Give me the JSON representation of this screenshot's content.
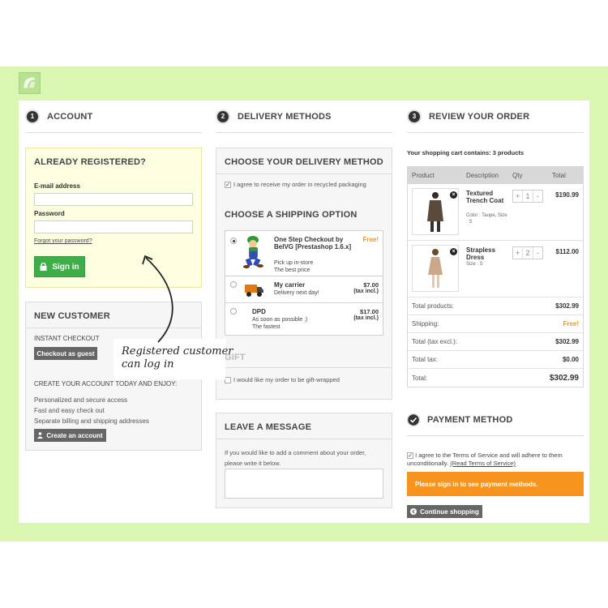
{
  "brand": {
    "colors": {
      "band": "#d9f7b1",
      "green": "#3fae49",
      "orange": "#f7941d",
      "free": "#f7941d"
    }
  },
  "steps": {
    "account": {
      "num": "1",
      "title": "ACCOUNT"
    },
    "delivery": {
      "num": "2",
      "title": "DELIVERY METHODS"
    },
    "review": {
      "num": "3",
      "title": "REVIEW YOUR ORDER"
    },
    "payment": {
      "icon": "check-circle-icon",
      "title": "PAYMENT METHOD"
    }
  },
  "login": {
    "title": "ALREADY REGISTERED?",
    "email_label": "E-mail address",
    "email_value": "",
    "password_label": "Password",
    "password_value": "",
    "forgot": "Forgot your password?",
    "signin": "Sign in"
  },
  "new_customer": {
    "title": "NEW CUSTOMER",
    "instant": "INSTANT CHECKOUT",
    "guest_btn": "Checkout as guest",
    "create_head": "CREATE YOUR ACCOUNT TODAY AND ENJOY:",
    "benefits": [
      "Personalized and secure access",
      "Fast and easy check out",
      "Separate billing and shipping addresses"
    ],
    "create_btn": "Create an account"
  },
  "delivery": {
    "title": "CHOOSE YOUR DELIVERY METHOD",
    "recycled": "I agree to receive my order in recycled packaging",
    "shipping_title": "CHOOSE A SHIPPING OPTION",
    "carriers": [
      {
        "name": "One Step Checkout by BelVG [Prestashop 1.6.x]",
        "desc1": "Pick up in-store",
        "desc2": "The best price",
        "price": "Free!",
        "tax": "",
        "selected": true,
        "icon": "luigi-icon"
      },
      {
        "name": "My carrier",
        "desc1": "Delivery next day!",
        "desc2": "",
        "price": "$7.00",
        "tax": "(tax incl.)",
        "selected": false,
        "icon": "truck-icon"
      },
      {
        "name": "DPD",
        "desc1": "As soon as possible ;)",
        "desc2": "The fastest",
        "price": "$17.00",
        "tax": "(tax incl.)",
        "selected": false,
        "icon": ""
      }
    ],
    "gift_title": "GIFT",
    "gift_label": "I would like my order to be gift-wrapped"
  },
  "message": {
    "title": "LEAVE A MESSAGE",
    "hint": "If you would like to add a comment about your order, please write it below.",
    "value": ""
  },
  "cart": {
    "summary": "Your shopping cart contains: 3 products",
    "columns": [
      "Product",
      "Description",
      "Qty",
      "Total"
    ],
    "items": [
      {
        "name": "Textured Trench Coat",
        "attr": "Color : Taupe, Size : S",
        "qty": "1",
        "total": "$190.99"
      },
      {
        "name": "Strapless Dress",
        "attr": "Size : S",
        "qty": "2",
        "total": "$112.00"
      }
    ],
    "totals": [
      {
        "label": "Total products:",
        "value": "$302.99"
      },
      {
        "label": "Shipping:",
        "value": "Free!"
      },
      {
        "label": "Total (tax excl.):",
        "value": "$302.99"
      },
      {
        "label": "Total tax:",
        "value": "$0.00"
      },
      {
        "label": "Total:",
        "value": "$302.99"
      }
    ]
  },
  "payment": {
    "terms": "I agree to the Terms of Service and will adhere to them unconditionally.",
    "terms_link": "(Read Terms of Service)",
    "notice": "Please sign in to see payment methods.",
    "continue": "Continue shopping"
  },
  "annotation": {
    "line1": "Registered customer",
    "line2": "can log in"
  }
}
